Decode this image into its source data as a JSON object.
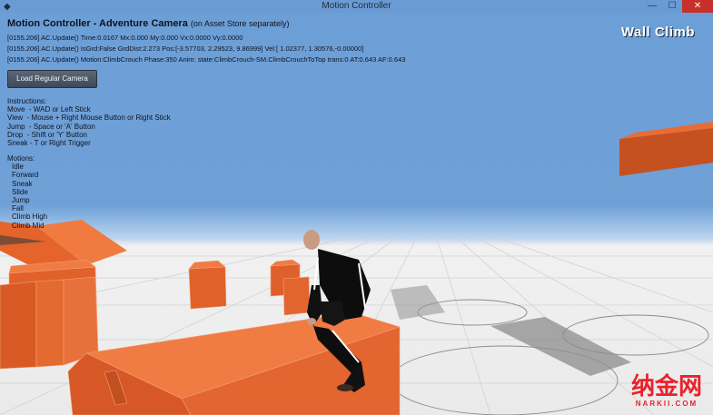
{
  "window": {
    "title": "Motion Controller",
    "controls": {
      "minimize": "—",
      "maximize": "☐",
      "close": "✕"
    }
  },
  "hud": {
    "title": "Motion Controller - Adventure Camera",
    "title_note": "(on Asset Store separately)",
    "debug_lines": [
      "[0155.206] AC.Update() Time:0.0167 Mx:0.000 My:0.000 Vx:0.0000 Vy:0.0000",
      "[0155.206] AC.Update() IsGrd:False GrdDist:2.273 Pos:[-3.57703, 2.29523, 9.86999] Vel:[ 1.02377, 1.30576,-0.00000]",
      "[0155.206] AC.Update() Motion:ClimbCrouch Phase:350 Anim: state:ClimbCrouch-SM.ClimbCrouchToTop trans:0 AT:0.643 AF:0.643"
    ],
    "load_button": "Load Regular Camera",
    "instructions_title": "Instructions:",
    "instructions": [
      "Move  - WAD or Left Stick",
      "View  - Mouse + Right Mouse Button or Right Stick",
      "Jump  - Space or 'A' Button",
      "Drop  - Shift or 'Y' Button",
      "Sneak - T or Right Trigger"
    ],
    "motions_title": "Motions:",
    "motions": [
      "Idle",
      "Forward",
      "Sneak",
      "Slide",
      "Jump",
      "Fall",
      "Climb High",
      "Climb Mid"
    ]
  },
  "mode_label": "Wall Climb",
  "watermark": {
    "cn": "纳金网",
    "en": "NARKII.COM"
  },
  "colors": {
    "sky": "#6d9fd7",
    "floor": "#eeeeee",
    "block": "#e4622a",
    "block_dark": "#b94b1c",
    "watermark": "#e8222b"
  }
}
